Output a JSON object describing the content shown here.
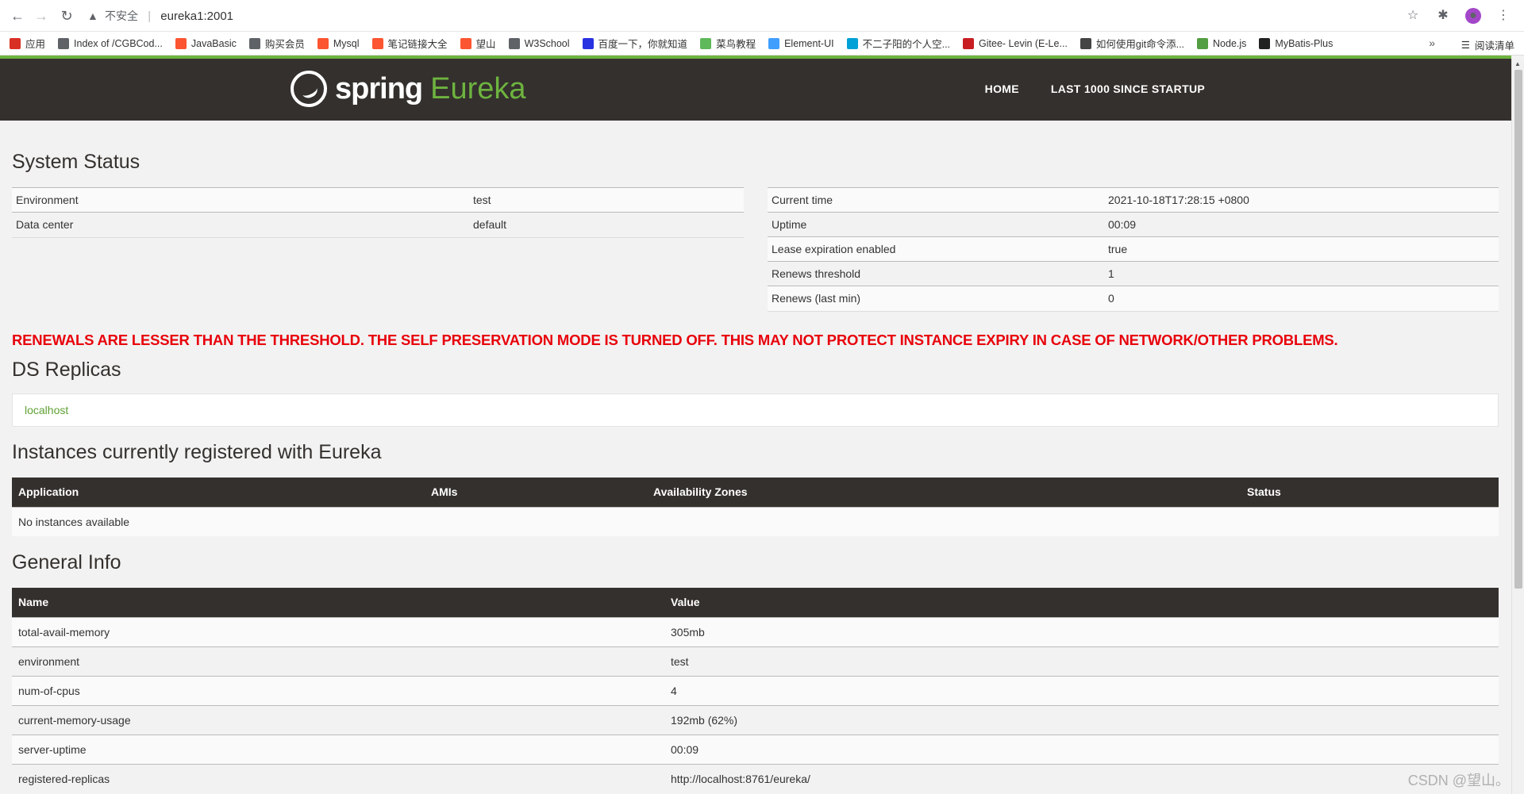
{
  "browser": {
    "insecure_label": "不安全",
    "url": "eureka1:2001",
    "bookmarks": [
      {
        "label": "应用",
        "icon": "apps-grid-icon",
        "color": "#d93025"
      },
      {
        "label": "Index of /CGBCod...",
        "icon": "globe-icon",
        "color": "#5f6368"
      },
      {
        "label": "JavaBasic",
        "icon": "csdn-c-icon",
        "color": "#fc5531"
      },
      {
        "label": "购买会员",
        "icon": "globe-icon",
        "color": "#5f6368"
      },
      {
        "label": "Mysql",
        "icon": "csdn-c-icon",
        "color": "#fc5531"
      },
      {
        "label": "笔记链接大全",
        "icon": "csdn-c-icon",
        "color": "#fc5531"
      },
      {
        "label": "望山",
        "icon": "csdn-c-icon",
        "color": "#fc5531"
      },
      {
        "label": "W3School",
        "icon": "globe-icon",
        "color": "#5f6368"
      },
      {
        "label": "百度一下，你就知道",
        "icon": "baidu-paw-icon",
        "color": "#2932e1"
      },
      {
        "label": "菜鸟教程",
        "icon": "runoob-icon",
        "color": "#5fb85a"
      },
      {
        "label": "Element-UI",
        "icon": "element-icon",
        "color": "#409eff"
      },
      {
        "label": "不二子阳的个人空...",
        "icon": "bilibili-icon",
        "color": "#00a1d6"
      },
      {
        "label": "Gitee- Levin (E-Le...",
        "icon": "gitee-icon",
        "color": "#c71d23"
      },
      {
        "label": "如何使用git命令添...",
        "icon": "juejin-icon",
        "color": "#444444"
      },
      {
        "label": "Node.js",
        "icon": "nodejs-icon",
        "color": "#539e43"
      },
      {
        "label": "MyBatis-Plus",
        "icon": "mybatis-bird-icon",
        "color": "#222222"
      }
    ],
    "more_label": "»",
    "reading_list_label": "阅读清单"
  },
  "navbar": {
    "logo_spring": "spring",
    "logo_eureka": "Eureka",
    "links": [
      "HOME",
      "LAST 1000 SINCE STARTUP"
    ]
  },
  "system_status": {
    "title": "System Status",
    "left": [
      {
        "k": "Environment",
        "v": "test"
      },
      {
        "k": "Data center",
        "v": "default"
      }
    ],
    "right": [
      {
        "k": "Current time",
        "v": "2021-10-18T17:28:15 +0800"
      },
      {
        "k": "Uptime",
        "v": "00:09"
      },
      {
        "k": "Lease expiration enabled",
        "v": "true"
      },
      {
        "k": "Renews threshold",
        "v": "1"
      },
      {
        "k": "Renews (last min)",
        "v": "0"
      }
    ]
  },
  "warning": "RENEWALS ARE LESSER THAN THE THRESHOLD. THE SELF PRESERVATION MODE IS TURNED OFF. THIS MAY NOT PROTECT INSTANCE EXPIRY IN CASE OF NETWORK/OTHER PROBLEMS.",
  "replicas": {
    "title": "DS Replicas",
    "items": [
      "localhost"
    ]
  },
  "instances": {
    "title": "Instances currently registered with Eureka",
    "headers": [
      "Application",
      "AMIs",
      "Availability Zones",
      "Status"
    ],
    "empty": "No instances available"
  },
  "general_info": {
    "title": "General Info",
    "headers": [
      "Name",
      "Value"
    ],
    "rows": [
      {
        "k": "total-avail-memory",
        "v": "305mb"
      },
      {
        "k": "environment",
        "v": "test"
      },
      {
        "k": "num-of-cpus",
        "v": "4"
      },
      {
        "k": "current-memory-usage",
        "v": "192mb (62%)"
      },
      {
        "k": "server-uptime",
        "v": "00:09"
      },
      {
        "k": "registered-replicas",
        "v": "http://localhost:8761/eureka/"
      }
    ]
  },
  "watermark": "CSDN @望山。",
  "colors": {
    "spring_green": "#6db33f",
    "navbar_dark": "#34302d",
    "warning_red": "#e8000b"
  }
}
